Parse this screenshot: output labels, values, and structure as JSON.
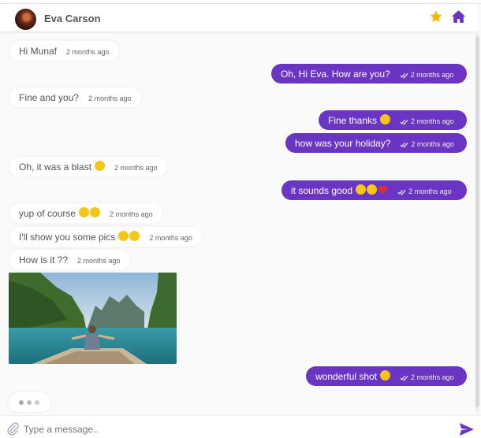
{
  "header": {
    "contact_name": "Eva Carson",
    "avatar_icon": "avatar",
    "favorite_icon": "star-icon",
    "home_icon": "home-icon"
  },
  "colors": {
    "outgoing_bubble": "#6a35c2",
    "incoming_bubble": "#ffffff",
    "star": "#f5b400",
    "home": "#6a35c2"
  },
  "messages": [
    {
      "direction": "in",
      "text": "Hi Munaf",
      "time": "2 months ago"
    },
    {
      "direction": "out",
      "text": "Oh, Hi Eva. How are you?",
      "time": "2 months ago"
    },
    {
      "direction": "in",
      "text": "Fine and you?",
      "time": "2 months ago"
    },
    {
      "direction": "out",
      "text": "Fine thanks",
      "emoji": [
        "smile"
      ],
      "time": "2 months ago"
    },
    {
      "direction": "out",
      "text": "how was your holiday?",
      "time": "2 months ago"
    },
    {
      "direction": "in",
      "text": "Oh, it was a blast",
      "emoji": [
        "heart-eyes"
      ],
      "time": "2 months ago"
    },
    {
      "direction": "out",
      "text": "it sounds good",
      "emoji": [
        "laughing",
        "laughing",
        "heart"
      ],
      "time": "2 months ago"
    },
    {
      "direction": "in",
      "text": "yup of course",
      "emoji": [
        "laughing",
        "laughing"
      ],
      "time": "2 months ago"
    },
    {
      "direction": "in",
      "text": "I'll show you some pics",
      "emoji": [
        "tongue",
        "sunglasses"
      ],
      "time": "2 months ago"
    },
    {
      "direction": "in",
      "text": "How is it ??",
      "time": "2 months ago"
    },
    {
      "direction": "in",
      "type": "image",
      "image": "photo of a woman sitting on a boat in a lake among cliffs"
    },
    {
      "direction": "out",
      "text": "wonderful shot",
      "emoji": [
        "heart-eyes"
      ],
      "time": "2 months ago"
    }
  ],
  "composer": {
    "placeholder": "Type a message..",
    "value": "",
    "attach_icon": "paperclip-icon",
    "send_icon": "send-icon"
  }
}
